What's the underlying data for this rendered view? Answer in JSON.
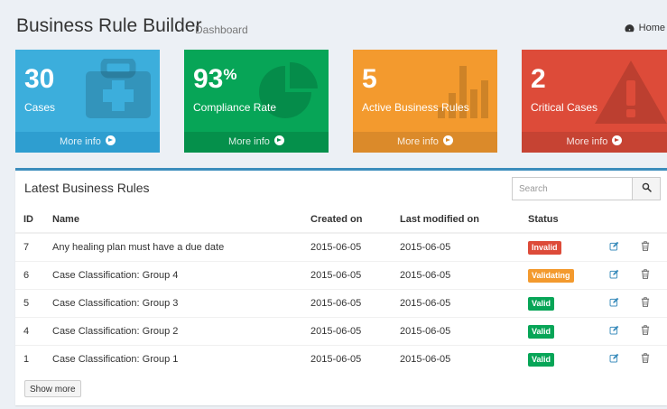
{
  "header": {
    "title": "Business Rule Builder",
    "subtitle": "Dashboard",
    "home_label": "Home"
  },
  "boxes": [
    {
      "number": "30",
      "suffix": "",
      "label": "Cases",
      "more": "More info",
      "icon": "medkit-icon",
      "color": "#3caedc"
    },
    {
      "number": "93",
      "suffix": "%",
      "label": "Compliance Rate",
      "more": "More info",
      "icon": "pie-chart-icon",
      "color": "#07a557"
    },
    {
      "number": "5",
      "suffix": "",
      "label": "Active Business Rules",
      "more": "More info",
      "icon": "bar-chart-icon",
      "color": "#f39a2e"
    },
    {
      "number": "2",
      "suffix": "",
      "label": "Critical Cases",
      "more": "More info",
      "icon": "warning-icon",
      "color": "#dd4b39"
    }
  ],
  "rules_panel": {
    "title": "Latest Business Rules",
    "search_placeholder": "Search",
    "columns": [
      "ID",
      "Name",
      "Created on",
      "Last modified on",
      "Status"
    ],
    "rows": [
      {
        "id": "7",
        "name": "Any healing plan must have a due date",
        "created": "2015-06-05",
        "modified": "2015-06-05",
        "status": "Invalid"
      },
      {
        "id": "6",
        "name": "Case Classification: Group 4",
        "created": "2015-06-05",
        "modified": "2015-06-05",
        "status": "Validating"
      },
      {
        "id": "5",
        "name": "Case Classification: Group 3",
        "created": "2015-06-05",
        "modified": "2015-06-05",
        "status": "Valid"
      },
      {
        "id": "4",
        "name": "Case Classification: Group 2",
        "created": "2015-06-05",
        "modified": "2015-06-05",
        "status": "Valid"
      },
      {
        "id": "1",
        "name": "Case Classification: Group 1",
        "created": "2015-06-05",
        "modified": "2015-06-05",
        "status": "Valid"
      }
    ],
    "show_more_label": "Show more"
  },
  "status_colors": {
    "Invalid": "#dd4b39",
    "Validating": "#f39a2e",
    "Valid": "#07a557"
  },
  "accent_color": "#3c8dbc"
}
